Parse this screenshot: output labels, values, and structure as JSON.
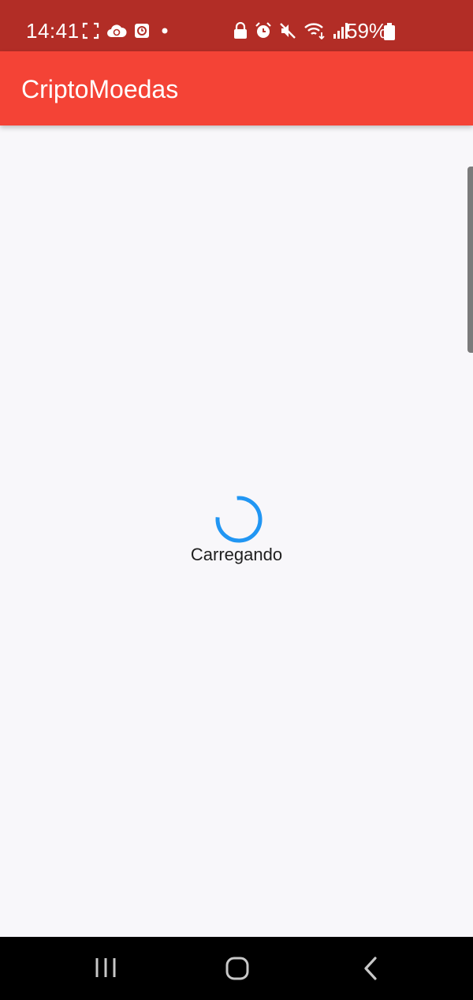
{
  "status_bar": {
    "time": "14:41",
    "battery": "59%",
    "left_icons": [
      "screenshot-frame-icon",
      "cloud-sync-icon",
      "app-badge-icon",
      "dot-icon"
    ],
    "right_icons": [
      "lock-icon",
      "alarm-icon",
      "mute-icon",
      "wifi-icon",
      "signal-icon",
      "battery-icon"
    ],
    "background": "#b22d26"
  },
  "app_bar": {
    "title": "CriptoMoedas",
    "background": "#f44336"
  },
  "content": {
    "loading_text": "Carregando",
    "spinner_color": "#2196f3",
    "background": "#f8f7fa"
  },
  "nav_bar": {
    "buttons": [
      "recents-icon",
      "home-icon",
      "back-icon"
    ]
  }
}
